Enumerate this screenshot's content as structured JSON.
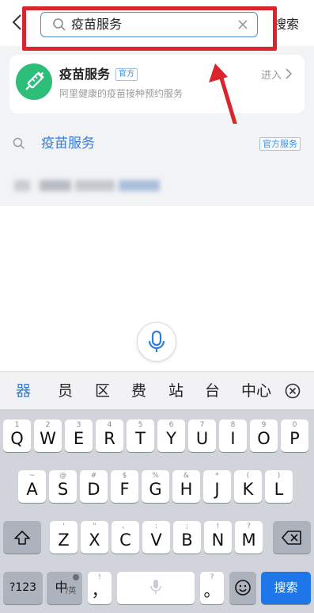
{
  "top_bar": {
    "back_icon": "chevron-left-icon",
    "search_value": "疫苗服务",
    "search_icon": "search-icon",
    "clear_icon": "close-icon",
    "search_button": "搜索",
    "highlight_color": "#d9252b"
  },
  "service_card": {
    "name": "疫苗服务",
    "badge": "官方",
    "description": "阿里健康的疫苗接种预约服务",
    "enter_label": "进入",
    "enter_icon": "chevron-right-icon",
    "logo_icon": "syringe-icon",
    "logo_color": "#2dbf7a"
  },
  "suggestion": {
    "text": "疫苗服务",
    "badge": "官方服务",
    "icon": "search-icon"
  },
  "annotation": {
    "arrow_color": "#d9252b"
  },
  "voice": {
    "icon": "microphone-icon"
  },
  "candidates": [
    "器",
    "员",
    "区",
    "费",
    "站",
    "台",
    "中心"
  ],
  "keyboard": {
    "row1": [
      {
        "k": "Q",
        "h": "1"
      },
      {
        "k": "W",
        "h": "2"
      },
      {
        "k": "E",
        "h": "3"
      },
      {
        "k": "R",
        "h": "4"
      },
      {
        "k": "T",
        "h": "5"
      },
      {
        "k": "Y",
        "h": "6"
      },
      {
        "k": "U",
        "h": "7"
      },
      {
        "k": "I",
        "h": "8"
      },
      {
        "k": "O",
        "h": "9"
      },
      {
        "k": "P",
        "h": "0"
      }
    ],
    "row2": [
      {
        "k": "A",
        "h": "~"
      },
      {
        "k": "S",
        "h": "@"
      },
      {
        "k": "D",
        "h": "#"
      },
      {
        "k": "F",
        "h": "$"
      },
      {
        "k": "G",
        "h": "%"
      },
      {
        "k": "H",
        "h": "&"
      },
      {
        "k": "J",
        "h": "*"
      },
      {
        "k": "K",
        "h": "("
      },
      {
        "k": "L",
        "h": ")"
      }
    ],
    "row3": [
      {
        "k": "Z",
        "h": "'"
      },
      {
        "k": "X",
        "h": "\""
      },
      {
        "k": "C",
        "h": "、"
      },
      {
        "k": "V",
        "h": ":"
      },
      {
        "k": "B",
        "h": ";"
      },
      {
        "k": "N",
        "h": "!"
      },
      {
        "k": "M",
        "h": "?"
      }
    ],
    "num_key": "?123",
    "lang_key": "中",
    "lang_sub": "/英",
    "comma_key": "，",
    "comma_hint": "!",
    "period_key": "。",
    "period_hint": "?",
    "emoji_icon": "emoji-icon",
    "search_key": "搜索",
    "accent_color": "#1f76e8"
  }
}
